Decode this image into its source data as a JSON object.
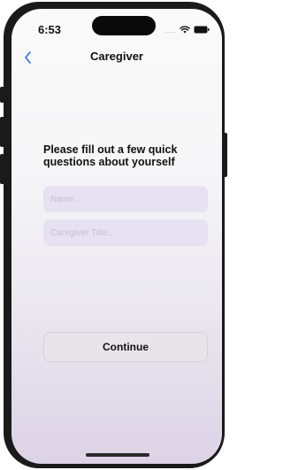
{
  "status_bar": {
    "time": "6:53",
    "dots": "....",
    "icons": [
      "wifi-icon",
      "battery-icon"
    ]
  },
  "nav": {
    "title": "Caregiver",
    "back_icon": "chevron-left-icon",
    "accent_color": "#1a73e8"
  },
  "form": {
    "prompt": "Please fill out a few quick questions about yourself",
    "name_field": {
      "placeholder": "Name...",
      "value": ""
    },
    "title_field": {
      "placeholder": "Caregiver Title...",
      "value": ""
    },
    "continue_label": "Continue"
  }
}
